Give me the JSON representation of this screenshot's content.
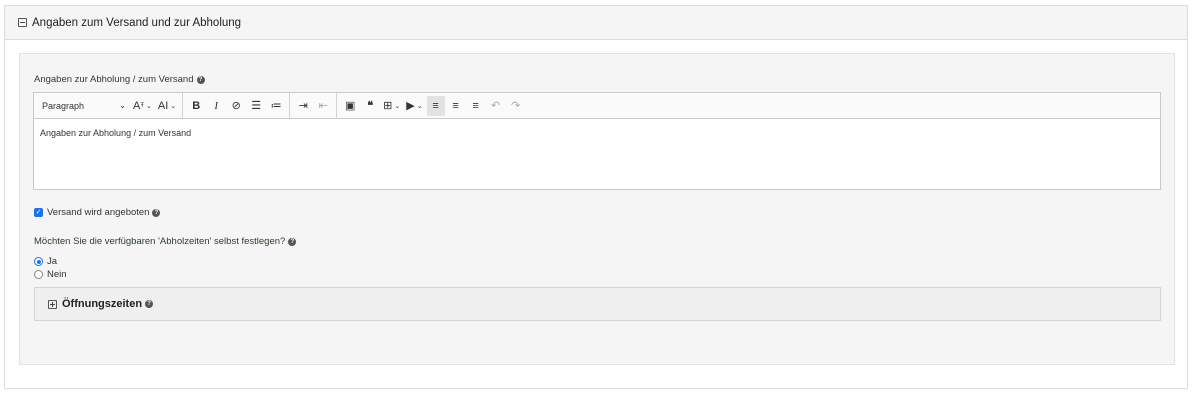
{
  "panel": {
    "title": "Angaben zum Versand und zur Abholung"
  },
  "editor": {
    "label": "Angaben zur Abholung / zum Versand",
    "format_select": "Paragraph",
    "content": "Angaben zur Abholung / zum Versand",
    "toolbar_icons": [
      "font-size-icon",
      "font-style-icon",
      "bold-icon",
      "italic-icon",
      "link-icon",
      "bulleted-list-icon",
      "numbered-list-icon",
      "indent-icon",
      "outdent-icon",
      "image-icon",
      "quote-icon",
      "table-icon",
      "media-icon",
      "align-left-icon",
      "align-right-icon",
      "align-center-icon",
      "undo-icon",
      "redo-icon"
    ]
  },
  "shipping_checkbox": {
    "label": "Versand wird angeboten",
    "checked": true
  },
  "pickup_question": {
    "label": "Möchten Sie die verfügbaren 'Abholzeiten' selbst festlegen?",
    "options": [
      "Ja",
      "Nein"
    ],
    "selected": "Ja"
  },
  "opening_hours": {
    "title": "Öffnungszeiten"
  },
  "colors": {
    "accent": "#1a73e8",
    "panel_bg": "#f5f5f5",
    "border": "#dcdcdc"
  }
}
